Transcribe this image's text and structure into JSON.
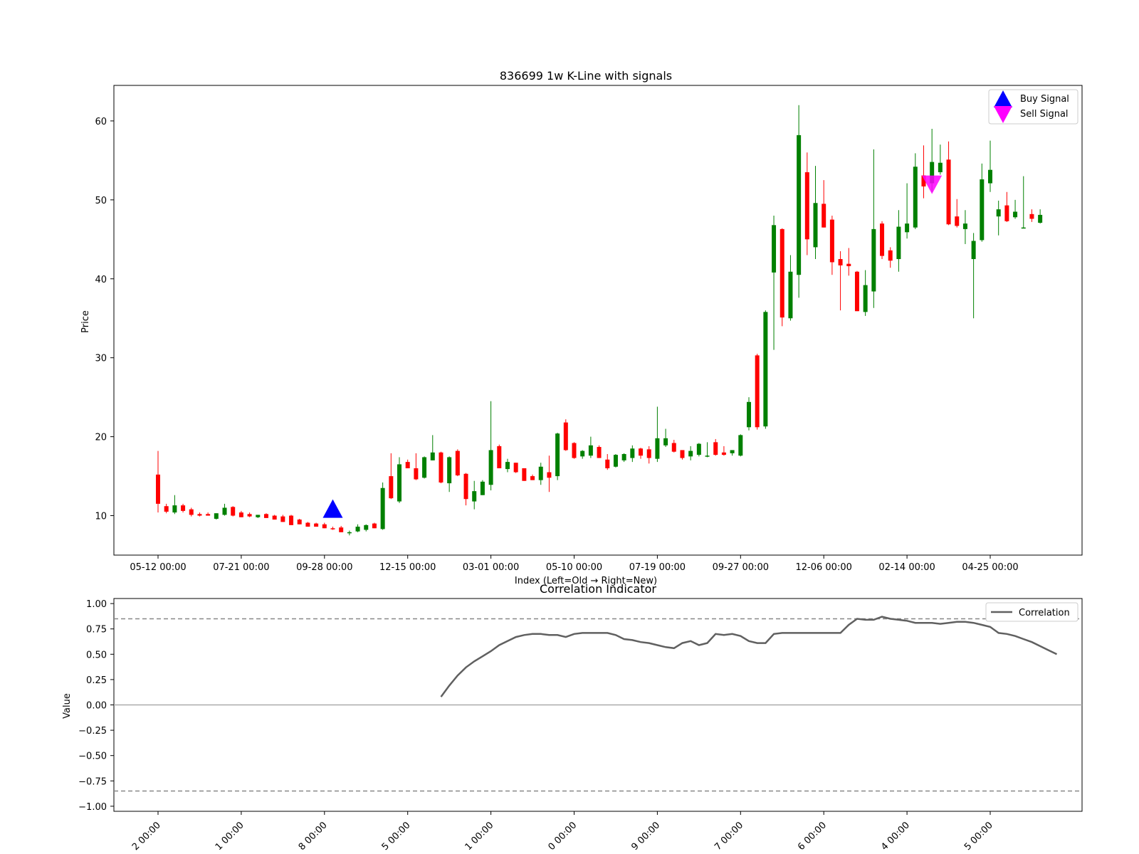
{
  "chart_data": [
    {
      "type": "candlestick",
      "title": "836699 1w K-Line with signals",
      "xlabel": "Index (Left=Old → Right=New)",
      "ylabel": "Price",
      "ylim": [
        5,
        64.5
      ],
      "yticks": [
        10,
        20,
        30,
        40,
        50,
        60
      ],
      "xticks": [
        {
          "i": 0,
          "label": "05-12 00:00"
        },
        {
          "i": 10,
          "label": "07-21 00:00"
        },
        {
          "i": 20,
          "label": "09-28 00:00"
        },
        {
          "i": 30,
          "label": "12-15 00:00"
        },
        {
          "i": 40,
          "label": "03-01 00:00"
        },
        {
          "i": 50,
          "label": "05-10 00:00"
        },
        {
          "i": 60,
          "label": "07-19 00:00"
        },
        {
          "i": 70,
          "label": "09-27 00:00"
        },
        {
          "i": 80,
          "label": "12-06 00:00"
        },
        {
          "i": 90,
          "label": "02-14 00:00"
        },
        {
          "i": 100,
          "label": "04-25 00:00"
        }
      ],
      "grid": false,
      "legend": "top-right",
      "up_color": "#008000",
      "down_color": "#ff0000",
      "ohlc": [
        [
          15.2,
          18.2,
          10.4,
          11.5
        ],
        [
          11.2,
          11.5,
          10.3,
          10.5
        ],
        [
          10.4,
          12.6,
          10.2,
          11.3
        ],
        [
          11.3,
          11.5,
          10.4,
          10.6
        ],
        [
          10.8,
          11.0,
          9.9,
          10.1
        ],
        [
          10.2,
          10.4,
          9.9,
          10.0
        ],
        [
          10.2,
          10.4,
          10.0,
          10.0
        ],
        [
          9.6,
          10.3,
          9.5,
          10.3
        ],
        [
          10.1,
          11.5,
          10.0,
          11.0
        ],
        [
          11.1,
          11.2,
          9.9,
          10.0
        ],
        [
          10.4,
          10.6,
          9.8,
          9.8
        ],
        [
          10.2,
          10.4,
          9.8,
          9.9
        ],
        [
          9.8,
          10.1,
          9.7,
          10.1
        ],
        [
          10.2,
          10.3,
          9.7,
          9.7
        ],
        [
          10.0,
          10.1,
          9.5,
          9.5
        ],
        [
          9.9,
          10.1,
          9.2,
          9.2
        ],
        [
          10.0,
          10.1,
          8.8,
          8.8
        ],
        [
          9.5,
          9.6,
          8.9,
          8.9
        ],
        [
          9.1,
          9.2,
          8.6,
          8.6
        ],
        [
          9.0,
          9.1,
          8.6,
          8.6
        ],
        [
          8.9,
          9.1,
          8.4,
          8.4
        ],
        [
          8.4,
          8.6,
          8.2,
          8.3
        ],
        [
          8.5,
          8.7,
          7.9,
          7.9
        ],
        [
          7.9,
          8.1,
          7.5,
          7.9
        ],
        [
          8.0,
          8.9,
          7.9,
          8.6
        ],
        [
          8.2,
          8.9,
          8.0,
          8.8
        ],
        [
          9.0,
          9.1,
          8.4,
          8.4
        ],
        [
          8.3,
          14.2,
          8.2,
          13.5
        ],
        [
          15.0,
          17.9,
          12.1,
          12.2
        ],
        [
          11.8,
          17.4,
          11.6,
          16.5
        ],
        [
          16.8,
          17.1,
          16.0,
          16.0
        ],
        [
          16.0,
          17.9,
          14.5,
          14.6
        ],
        [
          14.8,
          17.5,
          14.7,
          17.4
        ],
        [
          17.0,
          20.2,
          17.0,
          18.0
        ],
        [
          18.0,
          18.1,
          14.1,
          14.2
        ],
        [
          14.1,
          17.5,
          13.0,
          17.4
        ],
        [
          18.2,
          18.4,
          15.0,
          15.1
        ],
        [
          15.3,
          15.4,
          11.3,
          12.1
        ],
        [
          11.8,
          14.4,
          10.8,
          13.1
        ],
        [
          12.6,
          14.5,
          12.6,
          14.3
        ],
        [
          13.9,
          24.5,
          13.2,
          18.3
        ],
        [
          18.8,
          19.0,
          16.0,
          16.0
        ],
        [
          15.9,
          17.2,
          15.5,
          16.8
        ],
        [
          16.7,
          16.7,
          15.4,
          15.5
        ],
        [
          16.0,
          16.0,
          14.4,
          14.4
        ],
        [
          15.0,
          15.2,
          14.5,
          14.5
        ],
        [
          14.5,
          16.7,
          13.9,
          16.2
        ],
        [
          15.5,
          17.6,
          13.0,
          14.8
        ],
        [
          15.0,
          20.5,
          14.5,
          20.4
        ],
        [
          21.8,
          22.2,
          18.2,
          18.3
        ],
        [
          19.2,
          19.3,
          17.2,
          17.3
        ],
        [
          17.5,
          18.3,
          17.2,
          18.2
        ],
        [
          17.6,
          20.0,
          17.3,
          18.9
        ],
        [
          18.7,
          18.9,
          17.3,
          17.3
        ],
        [
          17.1,
          17.8,
          15.8,
          16.0
        ],
        [
          16.2,
          17.8,
          16.1,
          17.7
        ],
        [
          17.0,
          17.9,
          16.8,
          17.8
        ],
        [
          17.3,
          18.9,
          16.8,
          18.5
        ],
        [
          18.5,
          18.6,
          17.2,
          17.6
        ],
        [
          18.4,
          18.8,
          16.6,
          17.3
        ],
        [
          17.2,
          23.8,
          16.8,
          19.8
        ],
        [
          18.9,
          21.0,
          18.7,
          19.8
        ],
        [
          19.2,
          19.6,
          18.0,
          18.1
        ],
        [
          18.3,
          18.3,
          17.1,
          17.3
        ],
        [
          17.5,
          18.8,
          17.0,
          18.2
        ],
        [
          17.7,
          19.2,
          17.5,
          19.1
        ],
        [
          17.5,
          19.3,
          17.4,
          17.6
        ],
        [
          19.3,
          19.7,
          17.6,
          17.7
        ],
        [
          18.0,
          18.8,
          17.6,
          17.7
        ],
        [
          17.9,
          18.3,
          17.6,
          18.3
        ],
        [
          17.6,
          20.3,
          17.5,
          20.2
        ],
        [
          21.2,
          25.0,
          20.8,
          24.4
        ],
        [
          30.3,
          30.5,
          20.9,
          21.2
        ],
        [
          21.3,
          36.0,
          21.0,
          35.8
        ],
        [
          40.8,
          48.0,
          31.0,
          46.8
        ],
        [
          46.3,
          46.4,
          34.0,
          35.1
        ],
        [
          35.0,
          43.0,
          34.7,
          40.9
        ],
        [
          40.5,
          62.0,
          37.6,
          58.2
        ],
        [
          53.5,
          56.0,
          43.0,
          45.0
        ],
        [
          44.0,
          54.3,
          42.5,
          49.6
        ],
        [
          49.5,
          52.5,
          46.5,
          46.5
        ],
        [
          47.5,
          48.0,
          40.5,
          42.1
        ],
        [
          42.5,
          43.5,
          36.0,
          41.7
        ],
        [
          41.9,
          43.9,
          40.4,
          41.6
        ],
        [
          40.9,
          41.0,
          35.9,
          35.9
        ],
        [
          35.8,
          41.1,
          35.3,
          39.2
        ],
        [
          38.4,
          56.4,
          36.3,
          46.3
        ],
        [
          47.0,
          47.3,
          42.5,
          42.9
        ],
        [
          43.6,
          44.0,
          41.4,
          42.3
        ],
        [
          42.5,
          48.7,
          40.9,
          46.6
        ],
        [
          45.9,
          52.1,
          45.1,
          47.0
        ],
        [
          46.5,
          55.9,
          46.3,
          54.2
        ],
        [
          53.1,
          56.9,
          50.2,
          51.7
        ],
        [
          52.1,
          59.0,
          51.0,
          54.8
        ],
        [
          53.5,
          57.0,
          53.2,
          54.7
        ],
        [
          55.1,
          57.4,
          46.8,
          46.9
        ],
        [
          47.9,
          50.1,
          46.5,
          46.7
        ],
        [
          46.3,
          48.7,
          44.4,
          47.0
        ],
        [
          42.5,
          45.8,
          35.0,
          44.8
        ],
        [
          44.9,
          54.6,
          44.7,
          52.6
        ],
        [
          52.1,
          57.5,
          51.0,
          53.8
        ],
        [
          47.9,
          49.9,
          45.5,
          48.8
        ],
        [
          49.3,
          51.0,
          47.2,
          47.3
        ],
        [
          47.8,
          50.0,
          47.6,
          48.5
        ],
        [
          46.5,
          53.0,
          46.4,
          46.5
        ],
        [
          48.2,
          48.8,
          47.2,
          47.6
        ],
        [
          47.1,
          48.8,
          47.0,
          48.1
        ]
      ],
      "series": [
        {
          "name": "Buy Signal",
          "marker": "triangle-up",
          "color": "#0000ff",
          "points": [
            {
              "i": 21,
              "y": 10.8
            }
          ]
        },
        {
          "name": "Sell Signal",
          "marker": "triangle-down",
          "color": "#ff00ff",
          "points": [
            {
              "i": 93,
              "y": 52.0
            }
          ]
        }
      ]
    },
    {
      "type": "line",
      "title": "Correlation Indicator",
      "xlabel": "",
      "ylabel": "Value",
      "ylim": [
        -1.05,
        1.05
      ],
      "yticks": [
        -1.0,
        -0.75,
        -0.5,
        -0.25,
        0.0,
        0.25,
        0.5,
        0.75,
        1.0
      ],
      "ytick_labels": [
        "−1.00",
        "−0.75",
        "−0.50",
        "−0.25",
        "0.00",
        "0.25",
        "0.50",
        "0.75",
        "1.00"
      ],
      "xtick_labels": [
        "2 00:00",
        "1 00:00",
        "8 00:00",
        "5 00:00",
        "1 00:00",
        "0 00:00",
        "9 00:00",
        "7 00:00",
        "6 00:00",
        "4 00:00",
        "5 00:00"
      ],
      "grid": false,
      "legend": "top-right",
      "reference_lines": [
        {
          "y": 0.85,
          "style": "dashed",
          "color": "#888888"
        },
        {
          "y": -0.85,
          "style": "dashed",
          "color": "#888888"
        },
        {
          "y": 0.0,
          "style": "solid",
          "color": "#aaaaaa"
        }
      ],
      "series": [
        {
          "name": "Correlation",
          "color": "#606060",
          "x_start": 34,
          "values": [
            0.08,
            0.19,
            0.29,
            0.37,
            0.43,
            0.48,
            0.53,
            0.59,
            0.63,
            0.67,
            0.69,
            0.7,
            0.7,
            0.69,
            0.69,
            0.67,
            0.7,
            0.71,
            0.71,
            0.71,
            0.71,
            0.69,
            0.65,
            0.64,
            0.62,
            0.61,
            0.59,
            0.57,
            0.56,
            0.61,
            0.63,
            0.59,
            0.61,
            0.7,
            0.69,
            0.7,
            0.68,
            0.63,
            0.61,
            0.61,
            0.7,
            0.71,
            0.71,
            0.71,
            0.71,
            0.71,
            0.71,
            0.71,
            0.71,
            0.79,
            0.85,
            0.84,
            0.84,
            0.87,
            0.85,
            0.84,
            0.83,
            0.81,
            0.81,
            0.81,
            0.8,
            0.81,
            0.82,
            0.82,
            0.81,
            0.79,
            0.77,
            0.71,
            0.7,
            0.68,
            0.65,
            0.62,
            0.58,
            0.54,
            0.5
          ]
        }
      ]
    }
  ]
}
